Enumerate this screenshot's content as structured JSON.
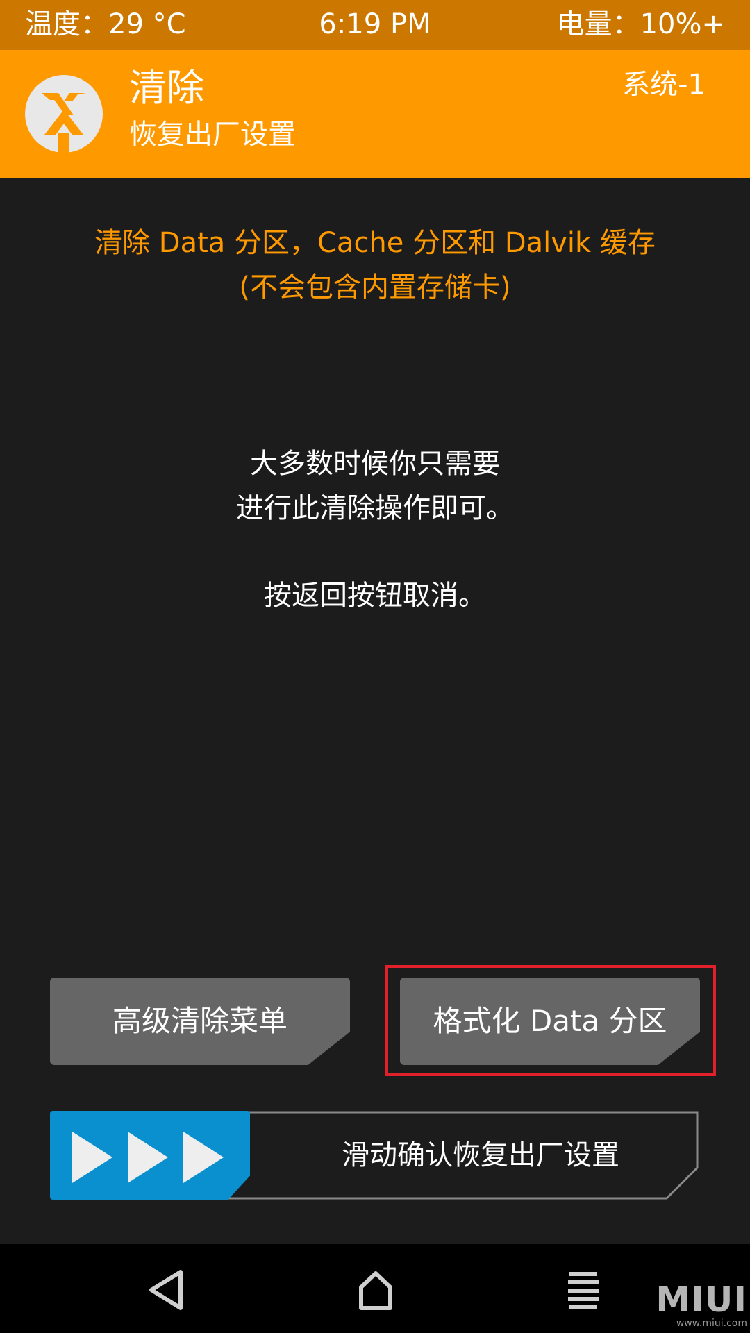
{
  "status_bar": {
    "temperature": "温度：29 °C",
    "time": "6:19 PM",
    "battery": "电量：10%+"
  },
  "header": {
    "logo_icon": "twrp-logo-icon",
    "title": "清除",
    "subtitle": "恢复出厂设置",
    "system": "系统-1"
  },
  "warning": {
    "line1": "清除 Data 分区，Cache 分区和 Dalvik 缓存",
    "line2": "(不会包含内置存储卡)"
  },
  "info": {
    "line1": "大多数时候你只需要",
    "line2": "进行此清除操作即可。",
    "line3": "按返回按钮取消。"
  },
  "buttons": {
    "advanced_wipe": "高级清除菜单",
    "format_data": "格式化 Data 分区"
  },
  "slider": {
    "label": "滑动确认恢复出厂设置",
    "icon": "triple-arrow-icon"
  },
  "nav": {
    "back_icon": "back-icon",
    "home_icon": "home-icon",
    "menu_icon": "menu-icon"
  },
  "watermark": {
    "logo": "MIUI",
    "url": "www.miui.com"
  },
  "colors": {
    "status_bar": "#cc7700",
    "header": "#ff9900",
    "warning_text": "#ff9900",
    "background": "#1c1c1c",
    "button": "#666666",
    "slider_handle": "#0a90cf",
    "highlight": "#e0202a"
  }
}
